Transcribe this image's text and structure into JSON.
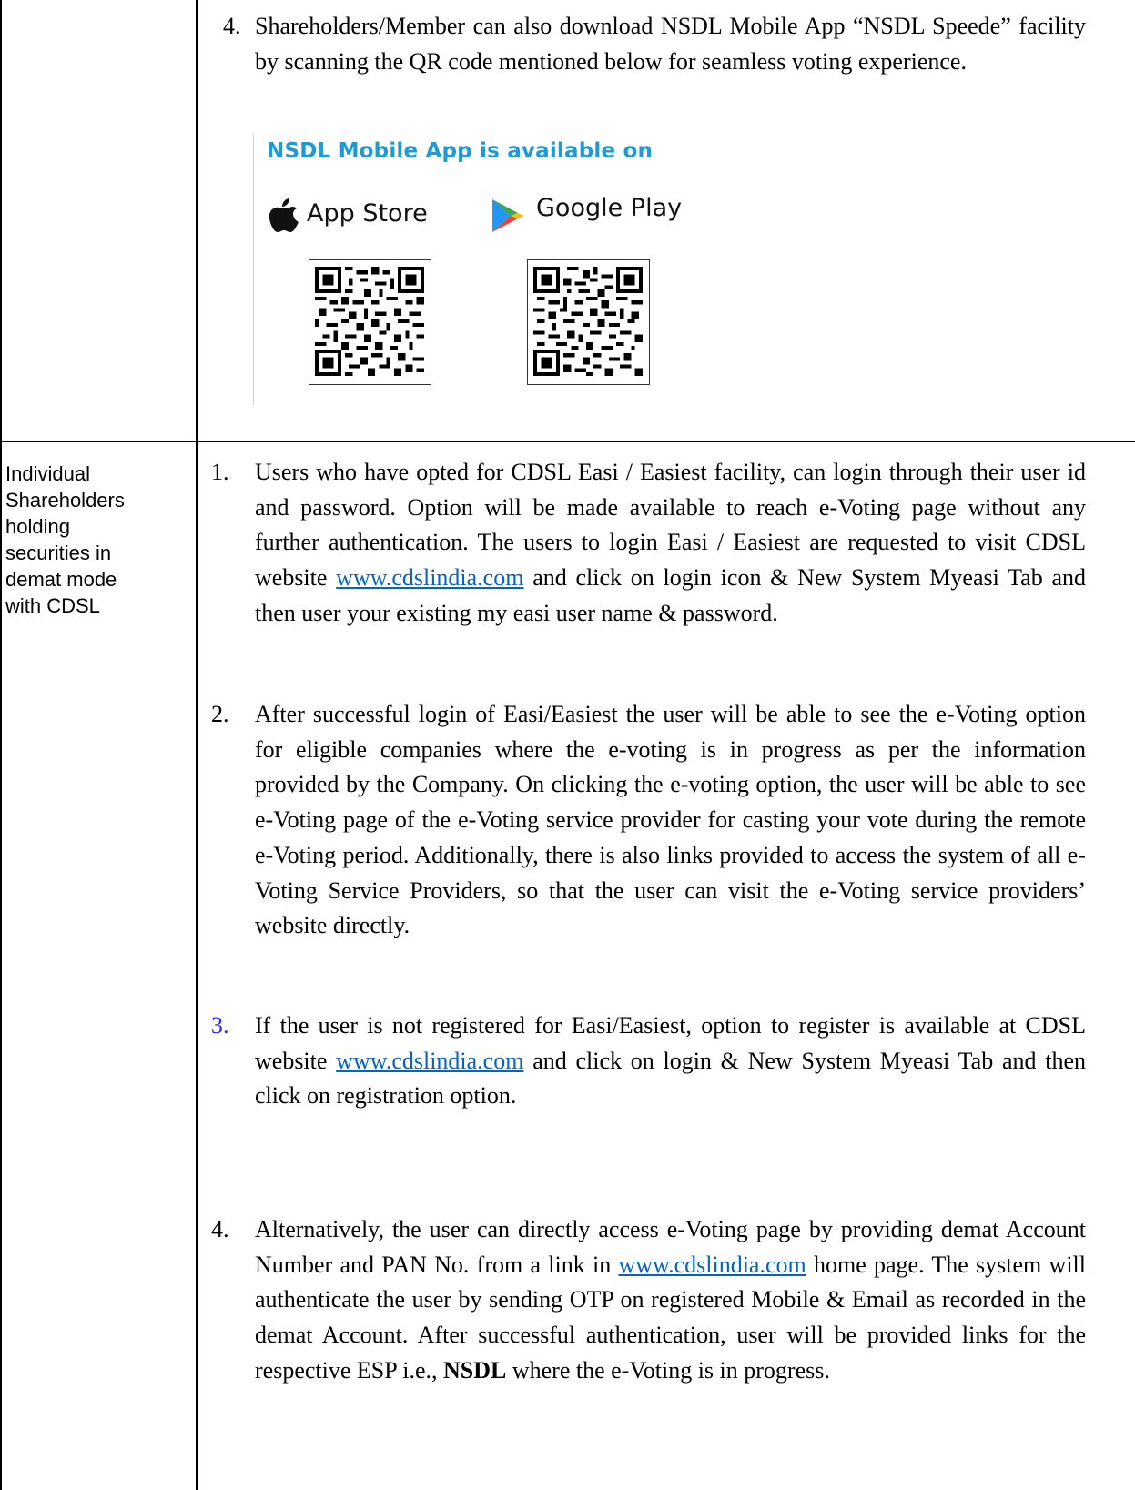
{
  "top_section": {
    "item_number": "4.",
    "item_text": "Shareholders/Member can also download NSDL Mobile App “NSDL Speede” facility by scanning the QR code mentioned below for seamless voting experience.",
    "app_banner": {
      "title": "NSDL Mobile App is available on",
      "title_color": "#1d9bd7",
      "stores": [
        {
          "label": "App Store",
          "icon": "apple-icon"
        },
        {
          "label": "Google Play",
          "icon": "google-play-icon"
        }
      ]
    }
  },
  "cdsl_section": {
    "row_label": [
      "Individual",
      "Shareholders",
      "holding",
      "securities in",
      "demat mode",
      "with CDSL"
    ],
    "items": [
      {
        "number": "1.",
        "text_before_link": "Users who have opted for CDSL Easi / Easiest facility, can login through their user id and password. Option will be made available to reach e-Voting page without any further authentication. The users to login Easi / Easiest are requested to visit CDSL website ",
        "link": "www.cdslindia.com",
        "text_after_link": " and click on login icon & New System Myeasi Tab and then user your existing my easi user name & password."
      },
      {
        "number": "2.",
        "text": "After successful login of Easi/Easiest the user will be able to see the e-Voting option for eligible companies where the e-voting is in progress as per the information provided by the Company. On clicking the e-voting option, the user will be able to see e-Voting page of the e-Voting service provider for casting your vote during the remote e-Voting period. Additionally, there is also links provided to access the system of all e-Voting Service Providers, so that the user can visit the e-Voting service providers’ website directly."
      },
      {
        "number": "3.",
        "number_color": "#2a2aff",
        "text_before_link": "If the user is not registered for Easi/Easiest, option to register is available at CDSL website ",
        "link": "www.cdslindia.com",
        "text_after_link": " and click on login & New System Myeasi Tab and then click on registration option."
      },
      {
        "number": "4.",
        "text_before_link": "Alternatively, the user can directly access e-Voting page by providing demat Account Number and PAN No. from a link in ",
        "link": "www.cdslindia.com",
        "text_mid": " home page. The system will authenticate the user by sending OTP on registered Mobile & Email as recorded in the demat Account. After successful authentication, user will be provided links for the respective ESP i.e., ",
        "bold": "NSDL",
        "text_after_bold": " where the e-Voting is in progress."
      }
    ]
  }
}
